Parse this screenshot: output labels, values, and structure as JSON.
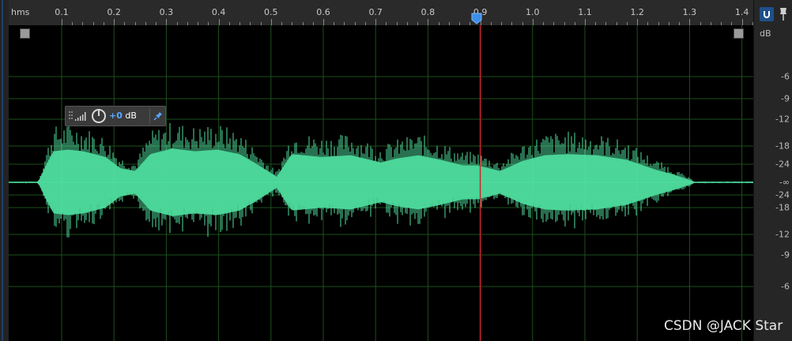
{
  "ruler": {
    "unit": "hms",
    "labels": [
      "0.1",
      "0.2",
      "0.3",
      "0.4",
      "0.5",
      "0.6",
      "0.7",
      "0.8",
      "0.9",
      "1.0",
      "1.1",
      "1.2",
      "1.3",
      "1.4"
    ]
  },
  "db_scale": {
    "unit": "dB",
    "labels": [
      "-6",
      "-9",
      "-12",
      "-18",
      "-24",
      "-∞",
      "-24",
      "-18",
      "-12",
      "-9",
      "-6"
    ]
  },
  "hud": {
    "gain_value": "+0",
    "gain_unit": "dB"
  },
  "playhead": {
    "time": 0.9
  },
  "watermark": "CSDN @JACK Star",
  "colors": {
    "waveform": "#4fe0a0",
    "grid": "#1d4f1d",
    "playhead": "#d2222a",
    "background": "#000000",
    "accent": "#2f7bd8"
  }
}
